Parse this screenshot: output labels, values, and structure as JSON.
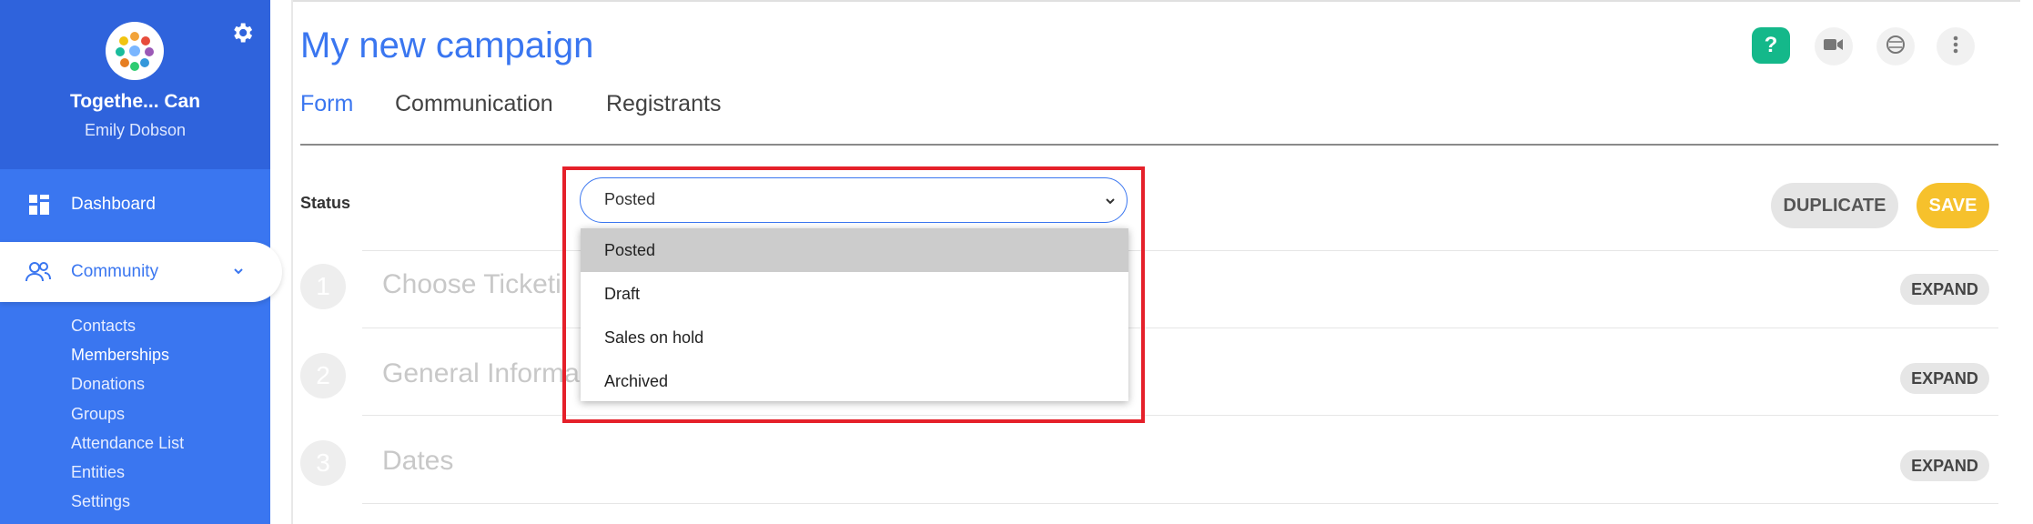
{
  "sidebar": {
    "org_name": "Togethe... Can",
    "user_name": "Emily Dobson",
    "nav": {
      "dashboard": "Dashboard",
      "community": "Community"
    },
    "community_items": [
      "Contacts",
      "Memberships",
      "Donations",
      "Groups",
      "Attendance List",
      "Entities",
      "Settings"
    ]
  },
  "header": {
    "title": "My new campaign",
    "tabs": [
      "Form",
      "Communication",
      "Registrants"
    ],
    "help_label": "?"
  },
  "form": {
    "status_label": "Status",
    "status_value": "Posted",
    "status_options": [
      "Posted",
      "Draft",
      "Sales on hold",
      "Archived"
    ],
    "duplicate_label": "DUPLICATE",
    "save_label": "SAVE"
  },
  "steps": [
    {
      "number": "1",
      "title": "Choose Ticketi",
      "expand_label": "EXPAND"
    },
    {
      "number": "2",
      "title": "General Informa",
      "expand_label": "EXPAND"
    },
    {
      "number": "3",
      "title": "Dates",
      "expand_label": "EXPAND"
    }
  ],
  "colors": {
    "sidebar": "#3a76f0",
    "sidebar_header": "#2f63dc",
    "accent": "#3a76f0",
    "help": "#14b88a",
    "save": "#f6c12c",
    "highlight": "#e5202a"
  },
  "icons": [
    "gear-icon",
    "dashboard-icon",
    "community-icon",
    "chevron-down-icon",
    "help-icon",
    "video-icon",
    "globe-icon",
    "more-vert-icon"
  ]
}
